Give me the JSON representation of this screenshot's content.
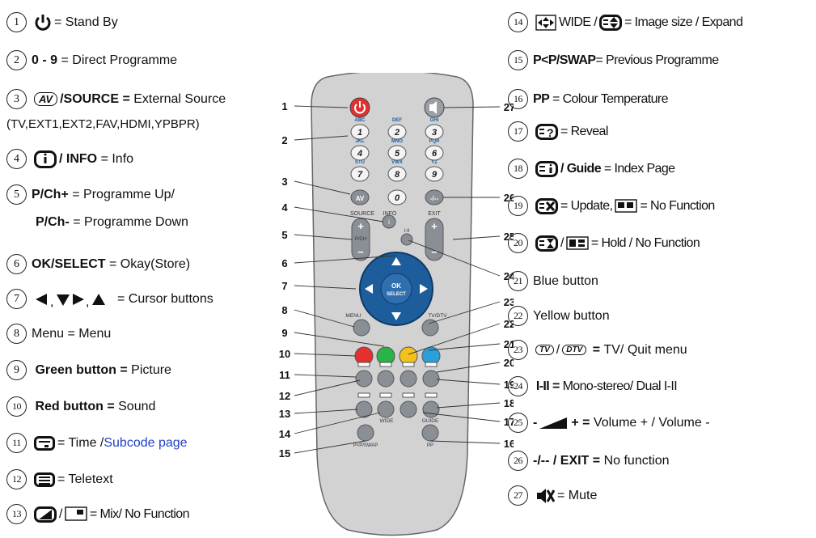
{
  "left": [
    {
      "n": "1",
      "label": "= Stand By"
    },
    {
      "n": "2",
      "key": "0 - 9",
      "label": "= Direct Programme"
    },
    {
      "n": "3",
      "key_icon": "AV",
      "key": "/SOURCE =",
      "label": "External Source",
      "sub": "(TV,EXT1,EXT2,FAV,HDMI,YPBPR)"
    },
    {
      "n": "4",
      "key": "/ INFO",
      "label": "= Info"
    },
    {
      "n": "5",
      "key": "P/Ch+",
      "label": "= Programme Up/",
      "key2": "P/Ch-",
      "label2": "= Programme Down"
    },
    {
      "n": "6",
      "key": "OK/SELECT",
      "label": "= Okay(Store)"
    },
    {
      "n": "7",
      "label": "= Cursor buttons"
    },
    {
      "n": "8",
      "label": "Menu = Menu"
    },
    {
      "n": "9",
      "key": "Green button =",
      "label": "Picture"
    },
    {
      "n": "10",
      "key": "Red button =",
      "label": "Sound"
    },
    {
      "n": "11",
      "label": "= Time / ",
      "label_blue": "Subcode page"
    },
    {
      "n": "12",
      "label": "= Teletext"
    },
    {
      "n": "13",
      "label": "= Mix/ No Function"
    }
  ],
  "right": [
    {
      "n": "14",
      "label_a": "WIDE / ",
      "label": "= Image size / Expand"
    },
    {
      "n": "15",
      "key": "P<P/SWAP",
      "label": "= Previous Programme"
    },
    {
      "n": "16",
      "key": "PP",
      "label": "= Colour Temperature"
    },
    {
      "n": "17",
      "label": "= Reveal"
    },
    {
      "n": "18",
      "key": "/ Guide",
      "label": "= Index Page"
    },
    {
      "n": "19",
      "label_a": "= Update, ",
      "label": "= No Function"
    },
    {
      "n": "20",
      "label": "= Hold / No Function"
    },
    {
      "n": "21",
      "label": "Blue button"
    },
    {
      "n": "22",
      "label": "Yellow button"
    },
    {
      "n": "23",
      "tv": "TV",
      "dtv": "DTV",
      "key": "=",
      "label": "TV/ Quit menu"
    },
    {
      "n": "24",
      "key": "I-II =",
      "label": "Mono-stereo/ Dual I-II"
    },
    {
      "n": "25",
      "key_a": "-",
      "key": "+ =",
      "label": "Volume + / Volume -"
    },
    {
      "n": "26",
      "key": "-/-- / EXIT =",
      "label": "No function"
    },
    {
      "n": "27",
      "label": "= Mute"
    }
  ],
  "remote": {
    "callouts": [
      "1",
      "2",
      "3",
      "4",
      "5",
      "6",
      "7",
      "8",
      "9",
      "10",
      "11",
      "12",
      "13",
      "14",
      "15",
      "16",
      "17",
      "18",
      "19",
      "20",
      "21",
      "22",
      "23",
      "24",
      "25",
      "26",
      "27"
    ],
    "letters": [
      "ABC",
      "DEF",
      "GHI",
      "JKL",
      "MNO",
      "PQR",
      "STU",
      "VWX",
      "YZ"
    ],
    "digits": [
      "1",
      "2",
      "3",
      "4",
      "5",
      "6",
      "7",
      "8",
      "9",
      "0"
    ],
    "av_key": "AV",
    "dash_key": "-/--",
    "source_label": "SOURCE",
    "info_label": "INFO",
    "exit_label": "EXIT",
    "info_key": "i",
    "pch_label": "P/CH",
    "iii_label": "I-II",
    "ok_label": "OK",
    "select_label": "SELECT",
    "menu_label": "MENU",
    "tvdtv_label": "TV/DTV",
    "wide_label": "WIDE",
    "guide_label": "GUIDE",
    "pswap_label": "P<P/SWAP",
    "pp_label": "PP",
    "plus": "+",
    "minus": "−",
    "colors": {
      "red": "#e53030",
      "green": "#2bb34a",
      "yellow": "#f2c21a",
      "blue": "#2b9fd8",
      "body": "#cfcfcf",
      "btn": "#8a8f95",
      "nav": "#1d5d9b",
      "power": "#e03030"
    }
  }
}
